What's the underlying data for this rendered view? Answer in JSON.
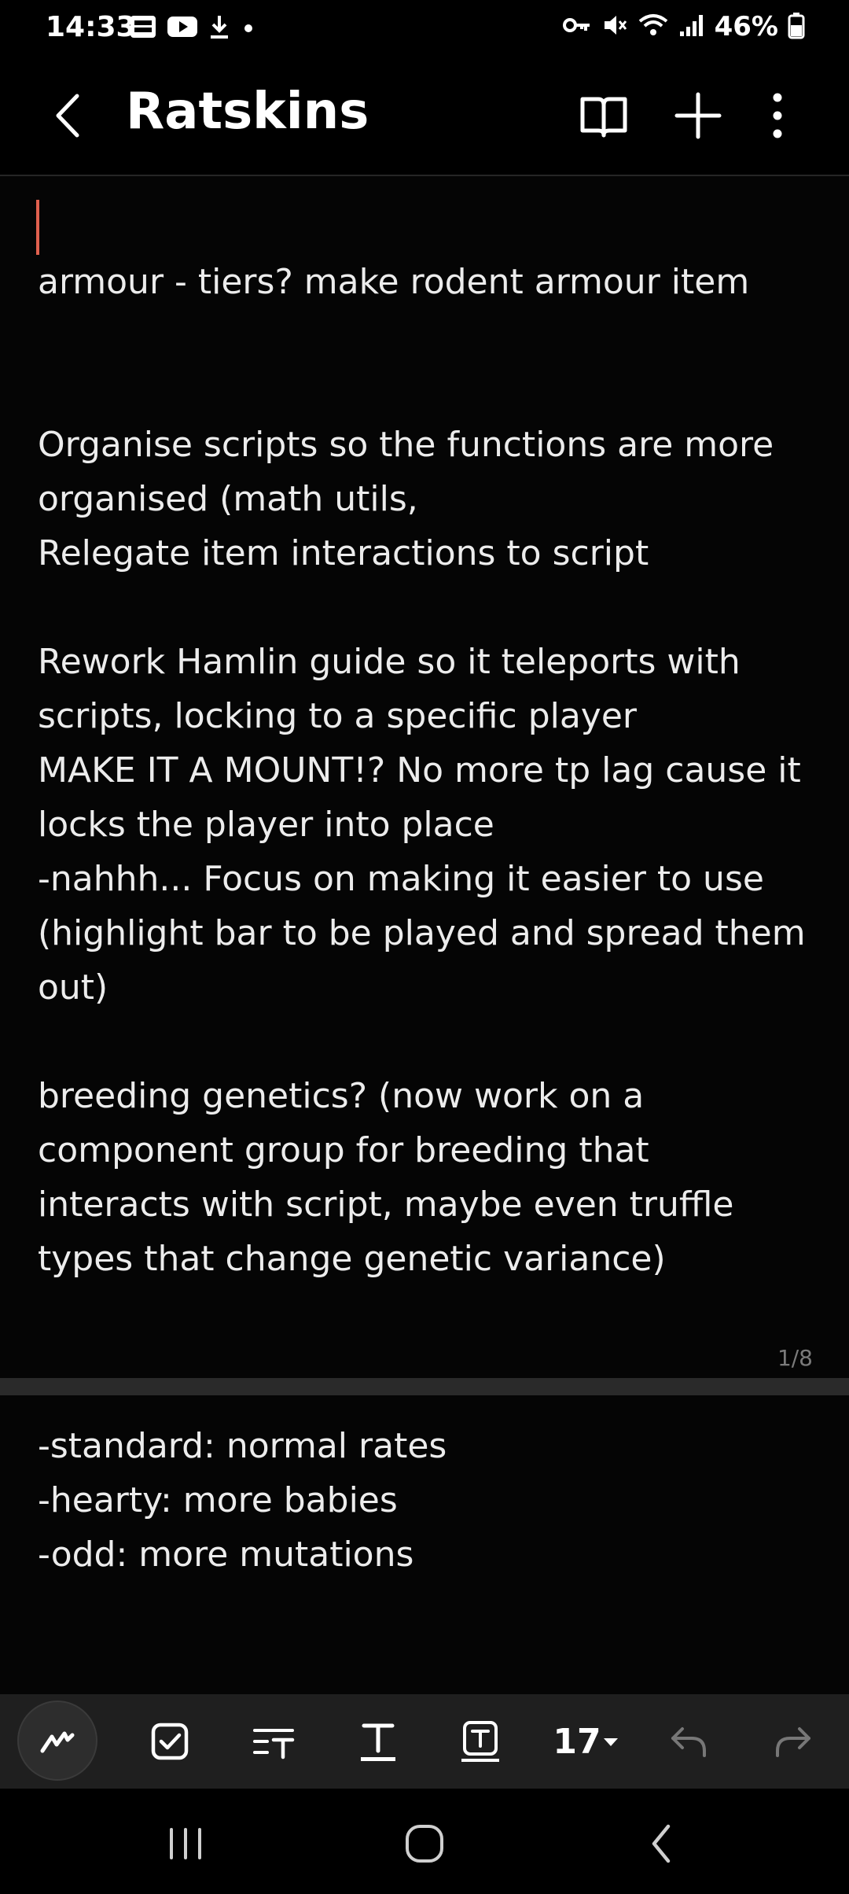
{
  "status_bar": {
    "time": "14:33",
    "battery_percent": "46%",
    "left_icons": [
      "webtoon-icon",
      "youtube-icon",
      "download-icon",
      "dot-icon"
    ],
    "right_icons": [
      "key-icon",
      "mute-icon",
      "wifi-icon",
      "signal-icon",
      "battery-icon"
    ]
  },
  "app_bar": {
    "title": "Ratskins",
    "actions": [
      "book-icon",
      "plus-icon",
      "more-vert-icon"
    ]
  },
  "note": {
    "page1_lines": [
      "armour - tiers? make rodent armour item",
      "",
      "",
      "Organise scripts so the functions are more",
      "organised (math utils,",
      "Relegate item interactions to script",
      "",
      "Rework Hamlin guide so it teleports with",
      "scripts, locking to a specific player",
      "MAKE IT A MOUNT!? No more tp lag cause it",
      "locks the player into place",
      "-nahhh... Focus on making it easier to use",
      "(highlight bar to be played and spread them",
      "out)",
      "",
      "breeding genetics? (now work on a",
      "component group for breeding that",
      "interacts with script, maybe even truffle",
      "types that change genetic variance)"
    ],
    "page_indicator": "1/8",
    "page2_lines": [
      "-standard: normal rates",
      "-hearty: more babies",
      "-odd: more mutations"
    ]
  },
  "toolbar": {
    "tools": [
      "pen-icon",
      "checkbox-icon",
      "paragraph-style-icon",
      "text-style-icon",
      "text-box-icon"
    ],
    "font_size": "17",
    "undo": "undo-icon",
    "redo": "redo-icon"
  },
  "colors": {
    "background": "#050505",
    "text": "#ececec",
    "cursor": "#e0604e",
    "toolbar": "#1f1f1f"
  }
}
